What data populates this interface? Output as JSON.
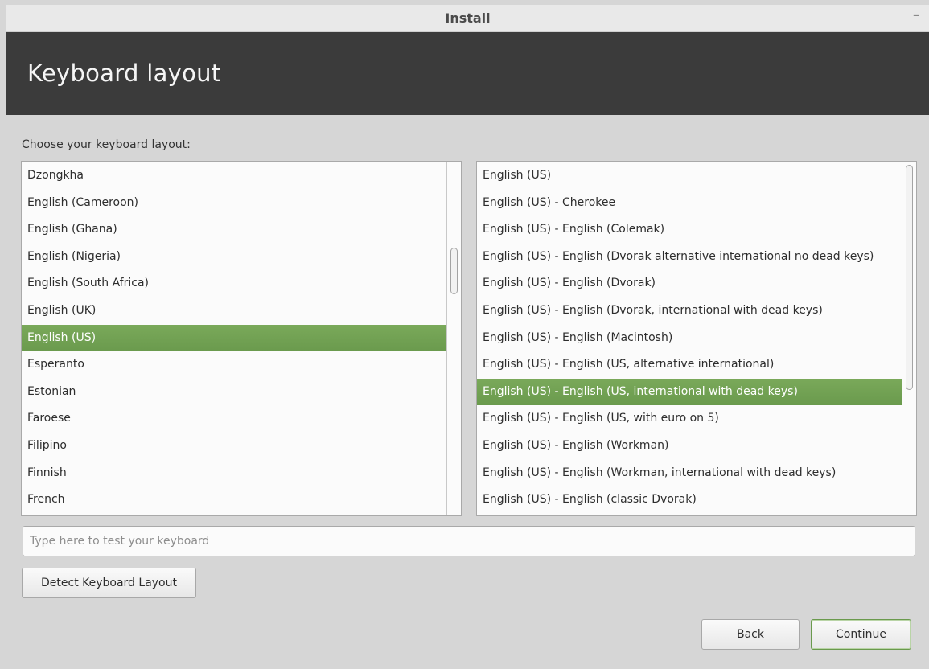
{
  "window": {
    "title": "Install",
    "minimize_label": "–"
  },
  "header": {
    "title": "Keyboard layout"
  },
  "prompt": "Choose your keyboard layout:",
  "layouts": {
    "items": [
      "Dzongkha",
      "English (Cameroon)",
      "English (Ghana)",
      "English (Nigeria)",
      "English (South Africa)",
      "English (UK)",
      "English (US)",
      "Esperanto",
      "Estonian",
      "Faroese",
      "Filipino",
      "Finnish",
      "French"
    ],
    "selected": "English (US)"
  },
  "variants": {
    "items": [
      "English (US)",
      "English (US) - Cherokee",
      "English (US) - English (Colemak)",
      "English (US) - English (Dvorak alternative international no dead keys)",
      "English (US) - English (Dvorak)",
      "English (US) - English (Dvorak, international with dead keys)",
      "English (US) - English (Macintosh)",
      "English (US) - English (US, alternative international)",
      "English (US) - English (US, international with dead keys)",
      "English (US) - English (US, with euro on 5)",
      "English (US) - English (Workman)",
      "English (US) - English (Workman, international with dead keys)",
      "English (US) - English (classic Dvorak)"
    ],
    "selected": "English (US) - English (US, international with dead keys)"
  },
  "test_input": {
    "value": "",
    "placeholder": "Type here to test your keyboard"
  },
  "buttons": {
    "detect": "Detect Keyboard Layout",
    "back": "Back",
    "continue": "Continue"
  },
  "colors": {
    "selection": "#71a452",
    "header_band": "#3b3b3b",
    "window_bg": "#d6d6d6"
  }
}
